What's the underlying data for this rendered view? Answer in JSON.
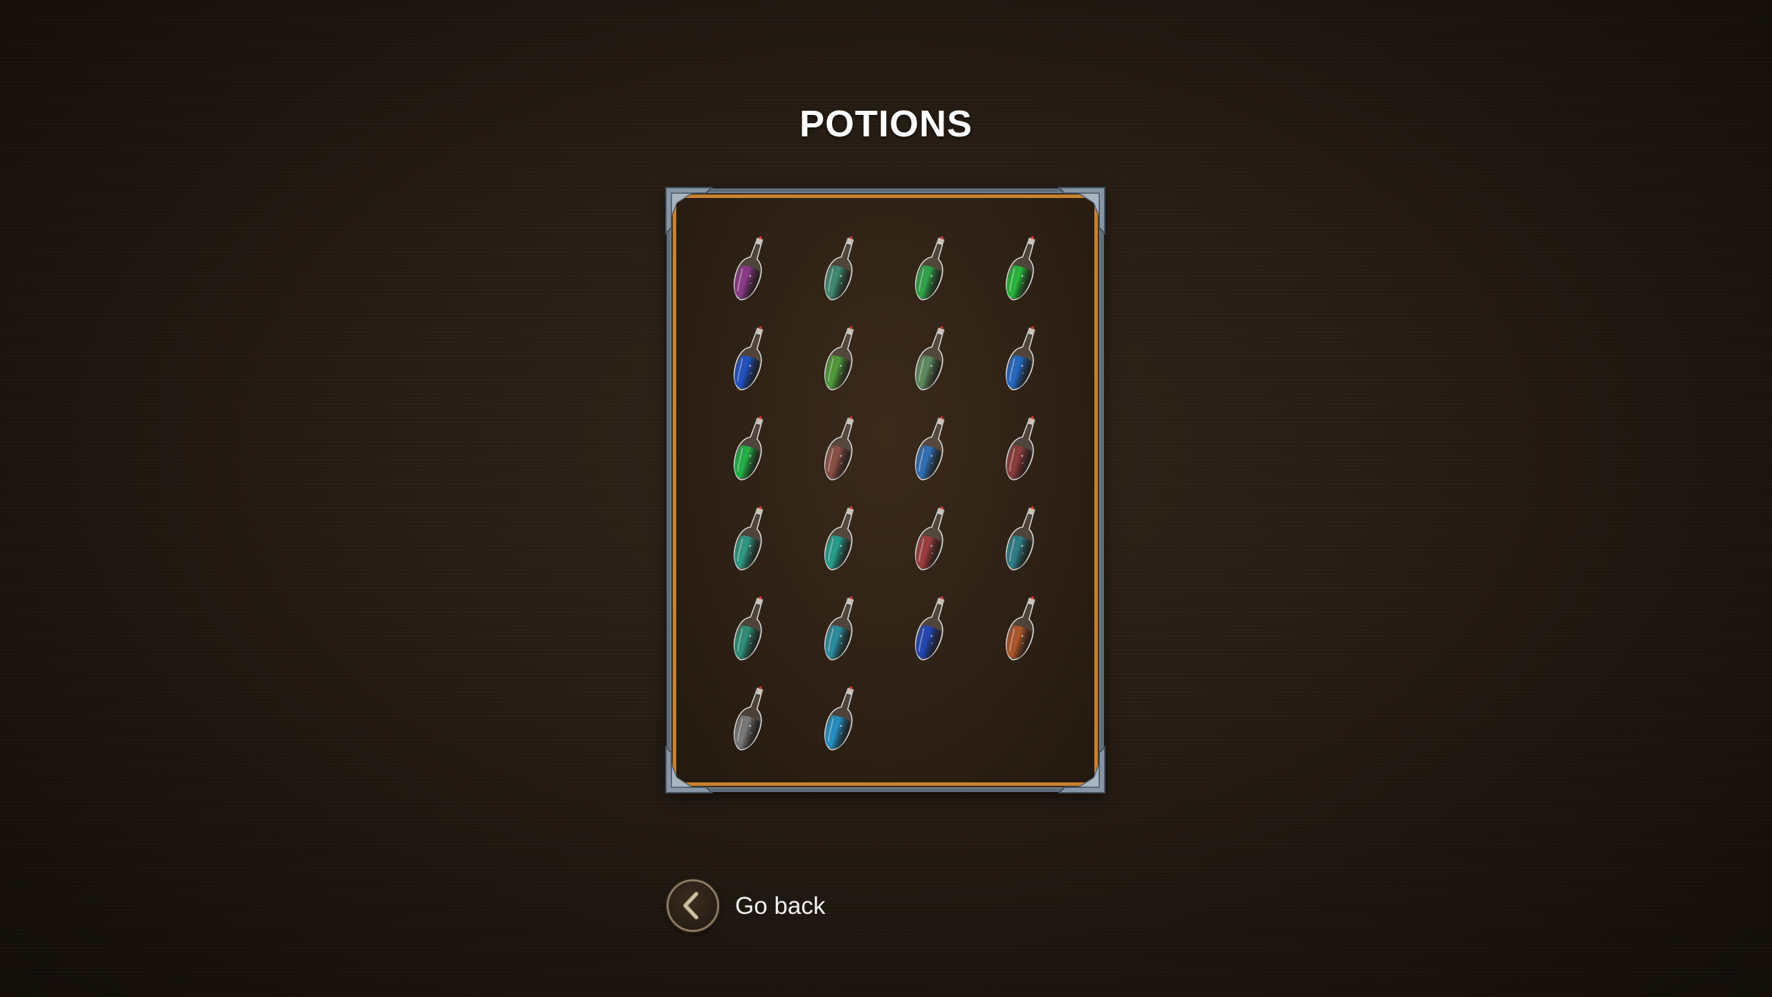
{
  "screen": {
    "title": "POTIONS"
  },
  "inventory": {
    "columns": 4,
    "potions": [
      {
        "icon": "potion-purple-icon",
        "color": "#8b3a8a"
      },
      {
        "icon": "potion-teal-icon",
        "color": "#3f8a72"
      },
      {
        "icon": "potion-green-icon",
        "color": "#2fa54a"
      },
      {
        "icon": "potion-green-icon",
        "color": "#28b83c"
      },
      {
        "icon": "potion-blue-icon",
        "color": "#1f52c4"
      },
      {
        "icon": "potion-green-icon",
        "color": "#4f9a3c"
      },
      {
        "icon": "potion-sage-icon",
        "color": "#5d8a60"
      },
      {
        "icon": "potion-blue-icon",
        "color": "#2468c2"
      },
      {
        "icon": "potion-green-icon",
        "color": "#22b347"
      },
      {
        "icon": "potion-brown-icon",
        "color": "#8a4f45"
      },
      {
        "icon": "potion-blue-icon",
        "color": "#2f6fb8"
      },
      {
        "icon": "potion-red-icon",
        "color": "#8c3c3c"
      },
      {
        "icon": "potion-teal-icon",
        "color": "#2e9a84"
      },
      {
        "icon": "potion-teal-icon",
        "color": "#259f8e"
      },
      {
        "icon": "potion-red-icon",
        "color": "#9c3d3d"
      },
      {
        "icon": "potion-teal-icon",
        "color": "#2e7f88"
      },
      {
        "icon": "potion-teal-icon",
        "color": "#2e9078"
      },
      {
        "icon": "potion-cyan-icon",
        "color": "#2a8fa0"
      },
      {
        "icon": "potion-blue-icon",
        "color": "#2346b8"
      },
      {
        "icon": "potion-orange-icon",
        "color": "#b0562a"
      },
      {
        "icon": "potion-gray-icon",
        "color": "#7a7a7a"
      },
      {
        "icon": "potion-cyan-icon",
        "color": "#2490c4"
      }
    ]
  },
  "footer": {
    "back_label": "Go back",
    "back_icon": "chevron-left-icon"
  },
  "colors": {
    "frame_steel": "#6d7e8e",
    "frame_gold": "#c8822f",
    "background": "#271d14"
  }
}
